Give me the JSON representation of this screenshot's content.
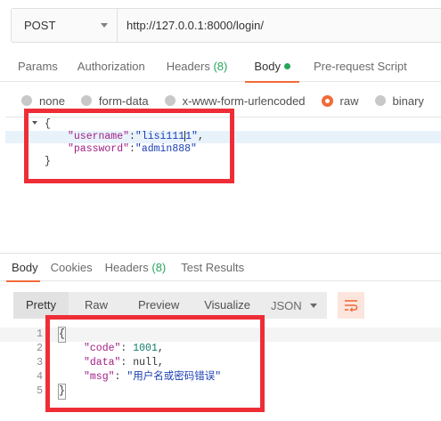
{
  "request": {
    "method": "POST",
    "url": "http://127.0.0.1:8000/login/"
  },
  "request_tabs": [
    {
      "label": "Params"
    },
    {
      "label": "Authorization"
    },
    {
      "label": "Headers",
      "count": "(8)"
    },
    {
      "label": "Body",
      "active": true
    },
    {
      "label": "Pre-request Script"
    }
  ],
  "body_types": {
    "options": [
      "none",
      "form-data",
      "x-www-form-urlencoded",
      "raw",
      "binary"
    ],
    "selected": "raw"
  },
  "request_body": {
    "open_brace": "{",
    "line1_key": "\"username\"",
    "line1_colon": ":",
    "line1_value_a": "\"lisi111",
    "line1_value_b": "1\"",
    "line1_comma": ",",
    "line2_key": "\"password\"",
    "line2_colon": ":",
    "line2_value": "\"admin888\"",
    "close_brace": "}"
  },
  "response_tabs": [
    {
      "label": "Body",
      "active": true
    },
    {
      "label": "Cookies"
    },
    {
      "label": "Headers",
      "count": "(8)"
    },
    {
      "label": "Test Results"
    }
  ],
  "response_view": {
    "modes": [
      "Pretty",
      "Raw",
      "Preview",
      "Visualize"
    ],
    "active_mode": "Pretty",
    "format": "JSON"
  },
  "response_body": {
    "line_numbers": [
      "1",
      "2",
      "3",
      "4",
      "5"
    ],
    "open_brace": "{",
    "code_key": "\"code\"",
    "code_value": "1001",
    "data_key": "\"data\"",
    "data_value": "null",
    "msg_key": "\"msg\"",
    "msg_value": "\"用户名或密码错误\"",
    "close_brace": "}"
  },
  "colors": {
    "accent": "#f26b3a",
    "highlight_box": "#ee2d36",
    "count_green": "#26a65b",
    "json_key": "#a11e83",
    "json_string": "#1b3fb3",
    "json_number": "#0f7b6c"
  }
}
